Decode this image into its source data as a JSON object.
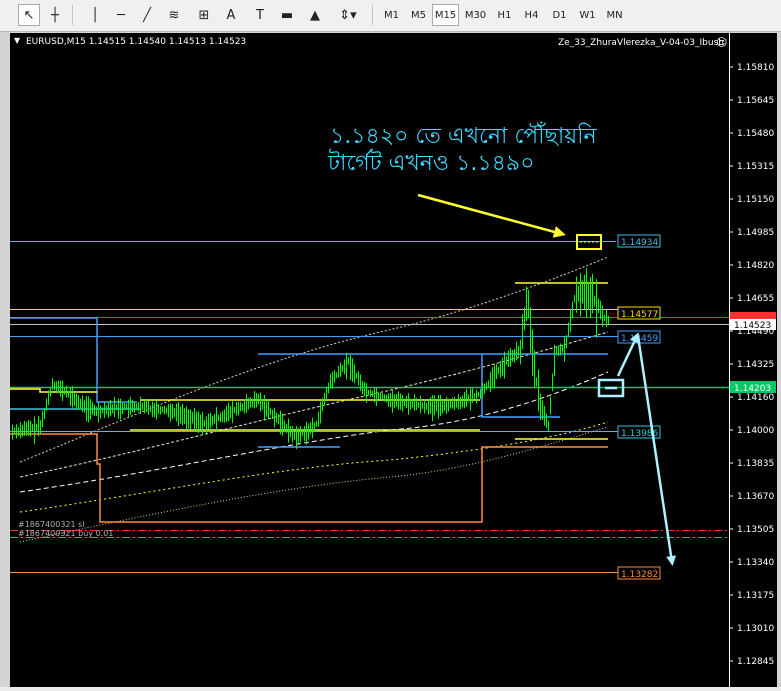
{
  "toolbar": {
    "timeframes": [
      {
        "label": "M1",
        "active": false
      },
      {
        "label": "M5",
        "active": false
      },
      {
        "label": "M15",
        "active": true
      },
      {
        "label": "M30",
        "active": false
      },
      {
        "label": "H1",
        "active": false
      },
      {
        "label": "H4",
        "active": false
      },
      {
        "label": "D1",
        "active": false
      },
      {
        "label": "W1",
        "active": false
      },
      {
        "label": "MN",
        "active": false
      }
    ],
    "tools": [
      "cursor-icon",
      "crosshair-icon",
      "vertical-line-icon",
      "horizontal-line-icon",
      "trendline-icon",
      "fibonacci-icon",
      "gann-grid-icon",
      "text-icon",
      "text-label-icon",
      "rectangle-icon",
      "triangle-icon",
      "arrows-dropdown-icon"
    ],
    "text_tool_label": "A",
    "label_tool_label": "T"
  },
  "chart": {
    "header": "EURUSD,M15  1.14515 1.14540 1.14513 1.14523",
    "expert": "Ze_33_ZhuraVlerezka_V-04-03_Ibush",
    "smiley": "☺",
    "price_axis": [
      "1.15810",
      "1.15645",
      "1.15480",
      "1.15315",
      "1.15150",
      "1.14985",
      "1.14820",
      "1.14655",
      "1.14490",
      "1.14325",
      "1.14160",
      "1.14000",
      "1.13835",
      "1.13670",
      "1.13505",
      "1.13340",
      "1.13175",
      "1.13010",
      "1.12845"
    ],
    "price_tags": [
      {
        "label": "1.14523",
        "bg": "#ffffff",
        "fg": "#000000"
      },
      {
        "label": "1.14203",
        "bg": "#00c864",
        "fg": "#ffffff"
      }
    ],
    "level_labels": [
      {
        "label": "1.14934",
        "color": "#40c0e0"
      },
      {
        "label": "1.14577",
        "color": "#ffd700"
      },
      {
        "label": "1.14459",
        "color": "#40a0ff"
      },
      {
        "label": "1.13986",
        "color": "#40c0e0"
      },
      {
        "label": "1.13282",
        "color": "#ff8c40"
      }
    ],
    "order_labels": [
      "#1867400321 sl",
      "#1867400321 buy 0.01"
    ],
    "annotation": {
      "line1": "১.১৪২০ তে এখনো পৌঁছায়নি",
      "line2": "টার্গেট এখনও ১.১৪৯০",
      "color": "#40d8ff"
    },
    "colors": {
      "background": "#000000",
      "candles": "#00ff00",
      "grid_axis": "#ffffff",
      "yellow": "#ffff30",
      "orange": "#ff8c40",
      "cyan": "#40c0e0",
      "blue": "#40a0ff",
      "red": "#ff3030"
    }
  }
}
